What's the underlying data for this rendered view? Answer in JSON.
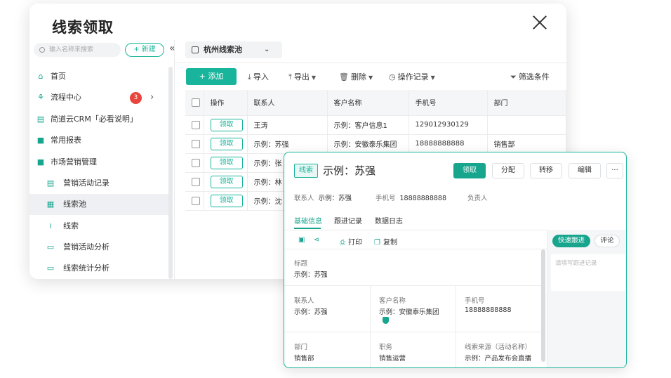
{
  "window": {
    "title": "线索领取"
  },
  "sidebar": {
    "search_placeholder": "输入名称来搜索",
    "new_label": "+ 新建",
    "collapse": "«",
    "items": [
      {
        "label": "首页",
        "icon": "home-icon",
        "glyph": "⌂"
      },
      {
        "label": "流程中心",
        "icon": "flow-icon",
        "glyph": "⚘",
        "badge": "3"
      },
      {
        "label": "简道云CRM「必看说明」",
        "icon": "doc-icon",
        "glyph": "▤"
      },
      {
        "label": "常用报表",
        "icon": "folder-icon",
        "glyph": "■"
      },
      {
        "label": "市场营销管理",
        "icon": "folder-open-icon",
        "glyph": "■"
      },
      {
        "label": "营销活动记录",
        "icon": "form-icon",
        "glyph": "▤"
      },
      {
        "label": "线索池",
        "icon": "pool-icon",
        "glyph": "▦"
      },
      {
        "label": "线索",
        "icon": "lead-icon",
        "glyph": "≀"
      },
      {
        "label": "营销活动分析",
        "icon": "chart-icon",
        "glyph": "▭"
      },
      {
        "label": "线索统计分析",
        "icon": "chart-icon",
        "glyph": "▭"
      }
    ]
  },
  "pool_selector": {
    "label": "杭州线索池",
    "caret": "⌄"
  },
  "toolbar": {
    "add": "+ 添加",
    "import": "导入",
    "export": "导出",
    "delete": "删除",
    "history": "操作记录",
    "filter": "筛选条件"
  },
  "table": {
    "headers": [
      "操作",
      "联系人",
      "客户名称",
      "手机号",
      "部门"
    ],
    "claim_label": "领取",
    "rows": [
      [
        "王涛",
        "示例：客户信息1",
        "129012930129",
        ""
      ],
      [
        "示例：苏强",
        "示例：安徽泰乐集团",
        "18888888888",
        "销售部"
      ],
      [
        "示例：张",
        "",
        "",
        ""
      ],
      [
        "示例：林",
        "",
        "",
        ""
      ],
      [
        "示例：沈",
        "",
        "",
        ""
      ]
    ]
  },
  "detail": {
    "tag": "线索",
    "title": "示例：苏强",
    "buttons": {
      "claim": "领取",
      "assign": "分配",
      "transfer": "转移",
      "edit": "编辑",
      "more": "···"
    },
    "meta": [
      {
        "label": "联系人",
        "value": "示例：苏强"
      },
      {
        "label": "手机号",
        "value": "18888888888"
      },
      {
        "label": "负责人",
        "value": ""
      }
    ],
    "tabs": [
      "基础信息",
      "跟进记录",
      "数据日志"
    ],
    "actions": {
      "print": "打印",
      "copy": "复制"
    },
    "fields": {
      "title_label": "标题",
      "title_value": "示例：苏强",
      "contact_label": "联系人",
      "contact_value": "示例：苏强",
      "customer_label": "客户名称",
      "customer_value": "示例：安徽泰乐集团",
      "phone_label": "手机号",
      "phone_value": "18888888888",
      "dept_label": "部门",
      "dept_value": "销售部",
      "position_label": "职务",
      "position_value": "销售运营",
      "source_label": "线索来源（活动名称）",
      "source_value": "示例：产品发布会直播"
    },
    "quick_follow": "快速跟进",
    "comment": "评论",
    "follow_placeholder": "请填写跟进记录"
  }
}
